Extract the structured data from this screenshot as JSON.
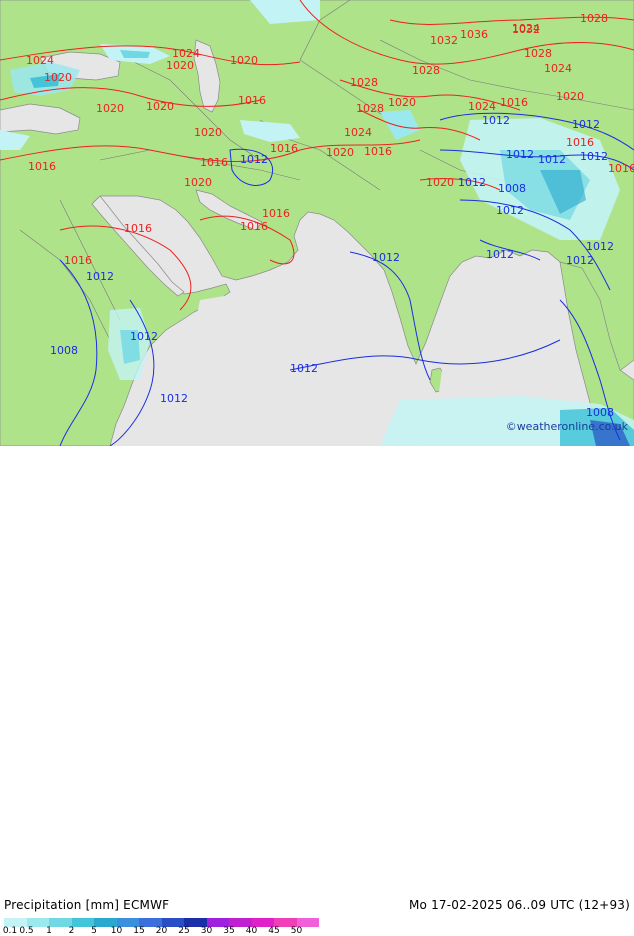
{
  "footer": {
    "title": "Precipitation [mm] ECMWF",
    "valid": "Mo 17-02-2025 06..09 UTC (12+93)"
  },
  "credit": "©weatheronline.co.uk",
  "legend": {
    "ticks": [
      "0.1",
      "0.5",
      "1",
      "2",
      "5",
      "10",
      "15",
      "20",
      "25",
      "30",
      "35",
      "40",
      "45",
      "50"
    ],
    "colors": [
      "#c3f3f5",
      "#9be8ee",
      "#6fd8e3",
      "#44c4d8",
      "#2aa8cf",
      "#3b8fdc",
      "#3c6fdc",
      "#2a4ec6",
      "#1a2ea8",
      "#a020e0",
      "#c020d0",
      "#e020c8",
      "#f040b8",
      "#f060d8"
    ]
  },
  "isobars": {
    "red": [
      "1024",
      "1024",
      "1020",
      "1020",
      "1020",
      "1020",
      "1020",
      "1016",
      "1016",
      "1016",
      "1016",
      "1016",
      "1016",
      "1016",
      "1020",
      "1028",
      "1024",
      "1020",
      "1032",
      "1036",
      "1032",
      "1028",
      "1028",
      "1028",
      "1024",
      "1020",
      "1024",
      "1016",
      "1028",
      "1020",
      "1016",
      "1024",
      "1020",
      "1020",
      "1016",
      "1016",
      "1016"
    ],
    "blue": [
      "1012",
      "1012",
      "1012",
      "1012",
      "1012",
      "1012",
      "1012",
      "1012",
      "1012",
      "1012",
      "1008",
      "1012",
      "1012",
      "1008",
      "1012",
      "1012",
      "1012",
      "1012",
      "1008"
    ]
  },
  "colors": {
    "land": "#aee38a",
    "sea": "#e6e6e6",
    "isobar_red": "#ee2020",
    "isobar_blue": "#1a2ee0",
    "border": "#777777"
  }
}
